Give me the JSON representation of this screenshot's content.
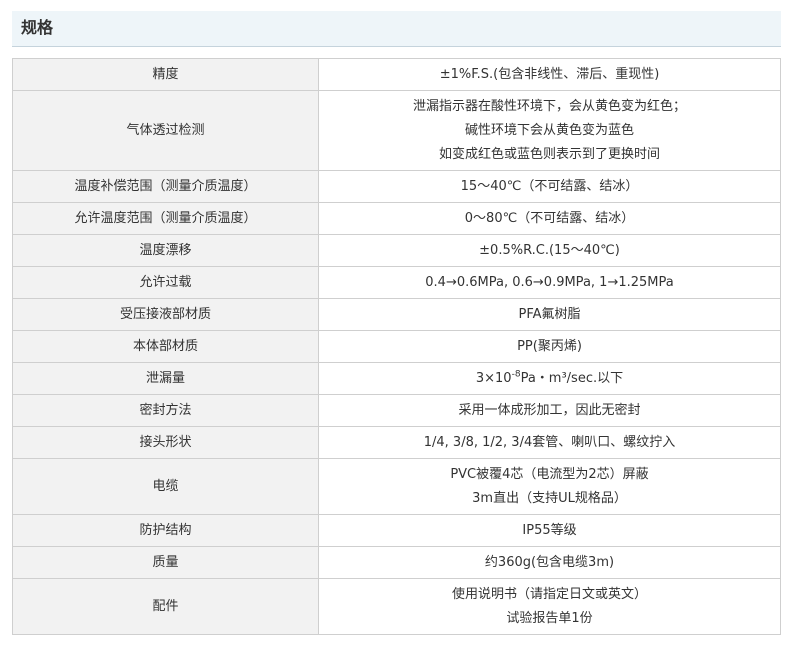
{
  "header": {
    "title": "规格"
  },
  "rows": [
    {
      "label": "精度",
      "lines": [
        "±1%F.S.(包含非线性、滞后、重现性)"
      ]
    },
    {
      "label": "气体透过检测",
      "lines": [
        "泄漏指示器在酸性环境下，会从黄色变为红色；",
        "碱性环境下会从黄色变为蓝色",
        "如变成红色或蓝色则表示到了更换时间"
      ]
    },
    {
      "label": "温度补偿范围（测量介质温度）",
      "lines": [
        "15～40℃（不可结露、结冰）"
      ]
    },
    {
      "label": "允许温度范围（测量介质温度）",
      "lines": [
        "0～80℃（不可结露、结冰）"
      ]
    },
    {
      "label": "温度漂移",
      "lines": [
        "±0.5%R.C.(15～40℃)"
      ]
    },
    {
      "label": "允许过载",
      "lines": [
        "0.4→0.6MPa, 0.6→0.9MPa, 1→1.25MPa"
      ]
    },
    {
      "label": "受压接液部材质",
      "lines": [
        "PFA氟树脂"
      ]
    },
    {
      "label": "本体部材质",
      "lines": [
        "PP(聚丙烯)"
      ]
    },
    {
      "label": "泄漏量",
      "leak": {
        "prefix": "3×10",
        "exponent": "-8",
        "suffix": "Pa・m³/sec.以下"
      }
    },
    {
      "label": "密封方法",
      "lines": [
        "采用一体成形加工，因此无密封"
      ]
    },
    {
      "label": "接头形状",
      "lines": [
        "1/4, 3/8, 1/2, 3/4套管、喇叭口、螺纹拧入"
      ]
    },
    {
      "label": "电缆",
      "lines": [
        "PVC被覆4芯（电流型为2芯）屏蔽",
        "3m直出（支持UL规格品）"
      ]
    },
    {
      "label": "防护结构",
      "lines": [
        "IP55等级"
      ]
    },
    {
      "label": "质量",
      "lines": [
        "约360g(包含电缆3m)"
      ]
    },
    {
      "label": "配件",
      "lines": [
        "使用说明书（请指定日文或英文）",
        "试验报告单1份"
      ]
    }
  ]
}
